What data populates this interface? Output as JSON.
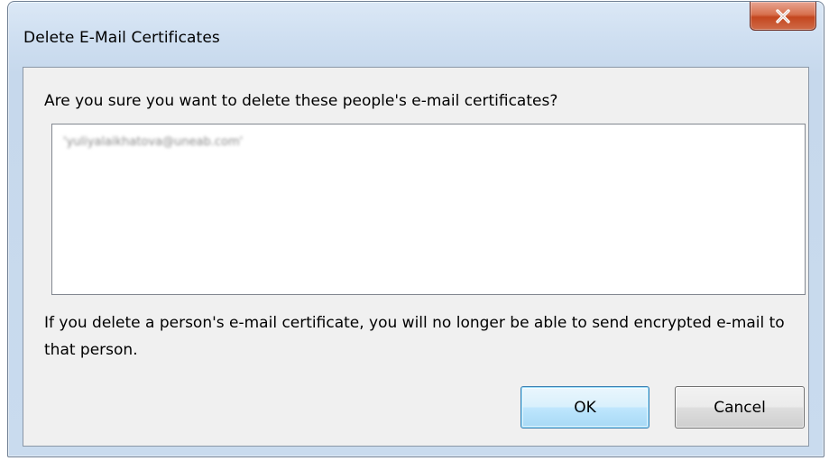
{
  "window": {
    "title": "Delete E-Mail Certificates",
    "close_icon": "close-icon"
  },
  "dialog": {
    "question": "Are you sure you want to delete these people's e-mail certificates?",
    "certificates": [
      "'yuliyalaikhatova@uneab.com'"
    ],
    "warning": "If you delete a person's e-mail certificate, you will no longer be able to send encrypted e-mail to that person."
  },
  "buttons": {
    "ok_label": "OK",
    "cancel_label": "Cancel"
  },
  "colors": {
    "close_button": "#c4471f",
    "ok_button_border": "#3c7fb1",
    "client_background": "#f0f0f0"
  }
}
